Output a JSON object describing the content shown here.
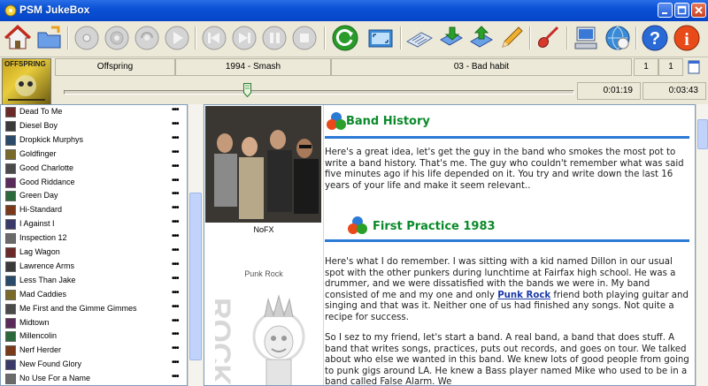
{
  "window": {
    "title": "PSM JukeBox"
  },
  "colors": {
    "titlebar": "#0a52d6",
    "heading": "#0a8a2a",
    "link": "#1a3aa8",
    "rule": "#2a7ad6"
  },
  "toolbar": {
    "icons": [
      "home-icon",
      "open-folder-icon",
      "cd-icon",
      "cd-eject-icon",
      "cd-burn-icon",
      "play-icon",
      "previous-icon",
      "next-icon",
      "pause-icon",
      "stop-icon",
      "refresh-icon",
      "fullscreen-icon",
      "keyboard-icon",
      "playlist-icon",
      "upload-icon",
      "pencil-icon",
      "guitar-icon",
      "computer-icon",
      "internet-icon",
      "help-icon",
      "info-icon"
    ]
  },
  "nowplaying": {
    "album_art_text": "OFFSPRING",
    "artist": "Offspring",
    "album": "1994 - Smash",
    "track": "03 - Bad habit",
    "counter_a": "1",
    "counter_b": "1",
    "progress": 0.36,
    "elapsed": "0:01:19",
    "total": "0:03:43"
  },
  "sidebar": {
    "artists": [
      {
        "name": "Dead To Me",
        "dots": "•••"
      },
      {
        "name": "Diesel Boy",
        "dots": "•••"
      },
      {
        "name": "Dropkick Murphys",
        "dots": "•••"
      },
      {
        "name": "Goldfinger",
        "dots": "•••"
      },
      {
        "name": "Good Charlotte",
        "dots": "•••"
      },
      {
        "name": "Good Riddance",
        "dots": "•••"
      },
      {
        "name": "Green Day",
        "dots": "•••"
      },
      {
        "name": "Hi-Standard",
        "dots": "•••"
      },
      {
        "name": "I Against I",
        "dots": "•••"
      },
      {
        "name": "Inspection 12",
        "dots": "•••"
      },
      {
        "name": "Lag Wagon",
        "dots": "•••"
      },
      {
        "name": "Lawrence Arms",
        "dots": "•••"
      },
      {
        "name": "Less Than Jake",
        "dots": "•••"
      },
      {
        "name": "Mad Caddies",
        "dots": "•••"
      },
      {
        "name": "Me First and the Gimme Gimmes",
        "dots": "•••"
      },
      {
        "name": "Midtown",
        "dots": "•••"
      },
      {
        "name": "Millencolin",
        "dots": "•••"
      },
      {
        "name": "Nerf Herder",
        "dots": "•••"
      },
      {
        "name": "New Found Glory",
        "dots": "•••"
      },
      {
        "name": "No Use For a Name",
        "dots": "•••"
      }
    ]
  },
  "content": {
    "photo_caption": "NoFX",
    "punk_caption": "Punk Rock",
    "section1_title": "Band History",
    "section1_text": "Here's a great idea, let's get the guy in the band who smokes the most pot to write a band history. That's me. The guy who couldn't remember what was said five minutes ago if his life depended on it. You try and write down the last 16 years of your life and make it seem relevant..",
    "section2_title": "First Practice 1983",
    "section2_text_a": "Here's what I do remember. I was sitting with a kid named Dillon in our usual spot with the other punkers during lunchtime at Fairfax high school. He was a drummer, and we were dissatisfied with the bands we were in. My band consisted of me and my one and only ",
    "section2_link": "Punk Rock",
    "section2_text_b": " friend both playing guitar and singing and that was it. Neither one of us had finished any songs. Not quite a recipe for success.",
    "section3_text": "So I sez to my friend, let's start a band. A real band, a band that does stuff. A band that writes songs, practices, puts out records, and goes on tour. We talked about who else we wanted in this band. We knew lots of good people from going to punk gigs around LA. He knew a Bass player named Mike who used to be in a band called False Alarm. We"
  }
}
